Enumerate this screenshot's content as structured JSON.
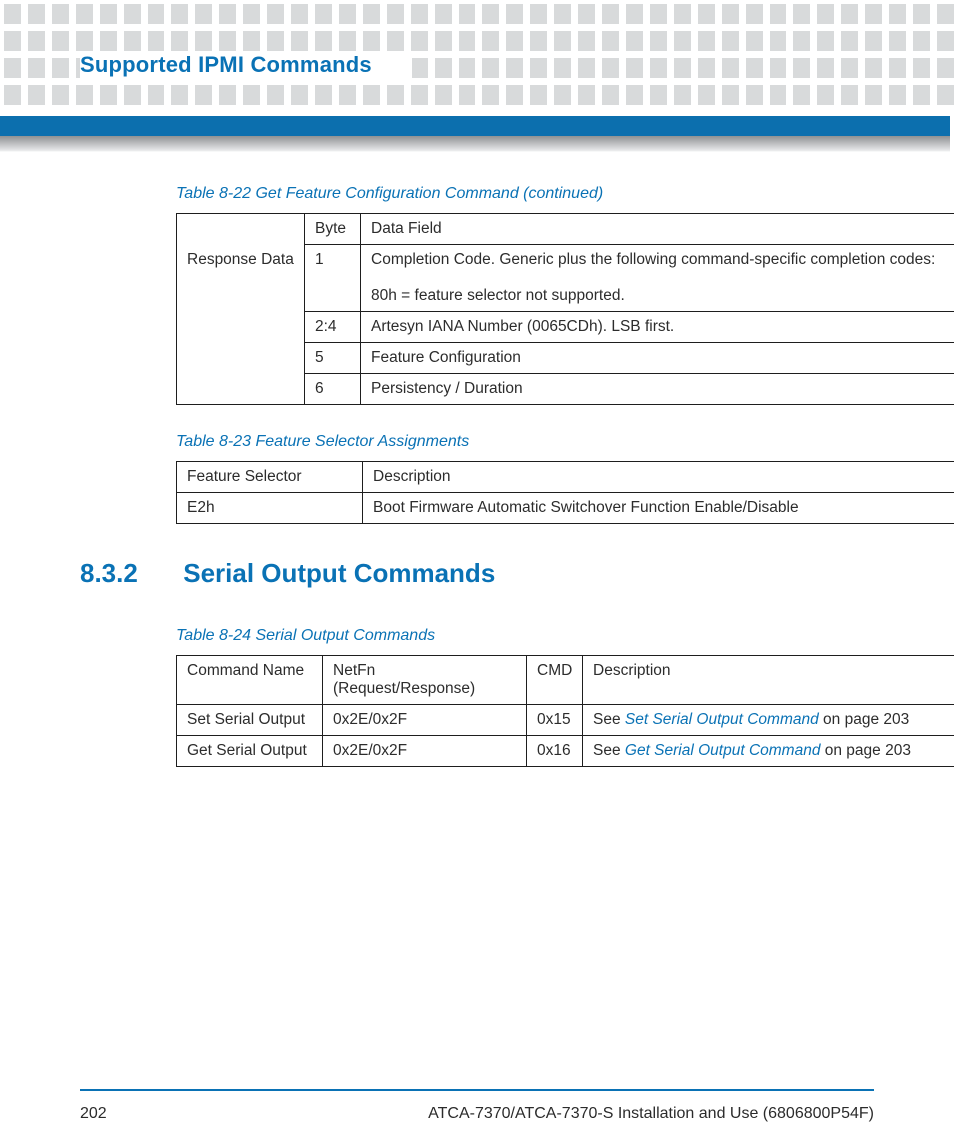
{
  "header": {
    "title": "Supported IPMI Commands"
  },
  "table22": {
    "caption": "Table 8-22 Get Feature Configuration Command (continued)",
    "col_byte": "Byte",
    "col_field": "Data Field",
    "rowgroup_label": "Response Data",
    "rows": [
      {
        "byte": "1",
        "field_line1": "Completion Code. Generic plus the following command-specific completion codes:",
        "field_line2": "80h = feature selector not supported."
      },
      {
        "byte": "2:4",
        "field": "Artesyn IANA Number (0065CDh). LSB first."
      },
      {
        "byte": "5",
        "field": "Feature Configuration"
      },
      {
        "byte": "6",
        "field": "Persistency / Duration"
      }
    ]
  },
  "table23": {
    "caption": "Table 8-23 Feature Selector Assignments",
    "col1": "Feature Selector",
    "col2": "Description",
    "rows": [
      {
        "sel": "E2h",
        "desc": "Boot Firmware Automatic Switchover Function Enable/Disable"
      }
    ]
  },
  "section": {
    "num": "8.3.2",
    "title": "Serial Output Commands"
  },
  "table24": {
    "caption": "Table 8-24 Serial Output Commands",
    "cols": {
      "c1": "Command Name",
      "c2": "NetFn (Request/Response)",
      "c3": "CMD",
      "c4": "Description"
    },
    "rows": [
      {
        "name": "Set Serial Output",
        "netfn": "0x2E/0x2F",
        "cmd": "0x15",
        "see_pre": "See ",
        "see_link": "Set Serial Output Command",
        "see_post": " on page 203"
      },
      {
        "name": "Get Serial Output",
        "netfn": "0x2E/0x2F",
        "cmd": "0x16",
        "see_pre": "See ",
        "see_link": "Get Serial Output Command",
        "see_post": " on page 203"
      }
    ]
  },
  "footer": {
    "page": "202",
    "doc": "ATCA-7370/ATCA-7370-S Installation and Use (6806800P54F)"
  }
}
